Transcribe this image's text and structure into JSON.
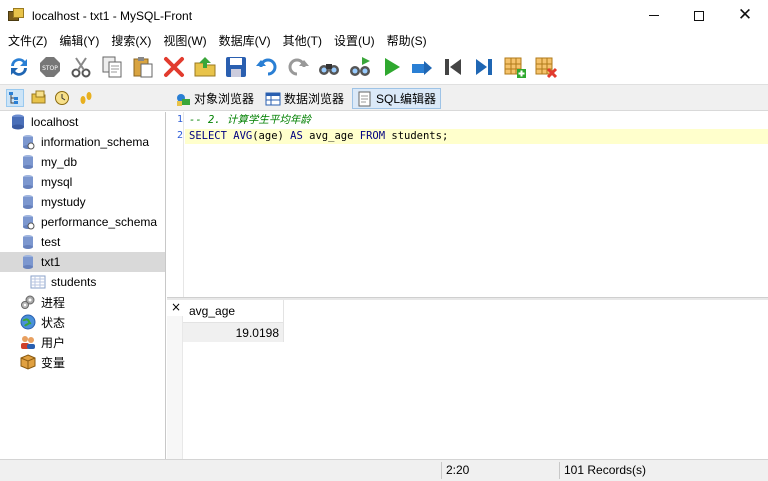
{
  "window": {
    "title": "localhost - txt1 - MySQL-Front",
    "minimize_label": "",
    "maximize_label": "",
    "close_label": "✕"
  },
  "menu": [
    "文件(Z)",
    "编辑(Y)",
    "搜索(X)",
    "视图(W)",
    "数据库(V)",
    "其他(T)",
    "设置(U)",
    "帮助(S)"
  ],
  "toolbar": {
    "icons": [
      "refresh-icon",
      "stop-icon",
      "cut-icon",
      "copy-icon",
      "paste-icon",
      "delete-icon",
      "open-icon",
      "save-icon",
      "undo-icon",
      "redo-icon",
      "find-icon",
      "replace-icon",
      "run-icon",
      "run-line-icon",
      "first-icon",
      "last-icon",
      "insert-row-icon",
      "delete-row-icon"
    ]
  },
  "views": {
    "object_browser": "对象浏览器",
    "data_browser": "数据浏览器",
    "sql_editor": "SQL编辑器"
  },
  "tree": {
    "root": "localhost",
    "databases": [
      "information_schema",
      "my_db",
      "mysql",
      "mystudy",
      "performance_schema",
      "test",
      "txt1"
    ],
    "selected": "txt1",
    "table": "students",
    "extras": [
      "进程",
      "状态",
      "用户",
      "变量"
    ]
  },
  "editor": {
    "line_numbers": [
      "1",
      "2"
    ],
    "line1_comment": "-- 2. 计算学生平均年龄",
    "line2": {
      "kw_select": "SELECT",
      "kw_avg": "AVG",
      "arg": "(age)",
      "kw_as": "AS",
      "alias": "avg_age",
      "kw_from": "FROM",
      "table": "students;"
    }
  },
  "results": {
    "close_label": "×",
    "column": "avg_age",
    "value": "19.0198"
  },
  "status": {
    "position": "2:20",
    "records": "101 Records(s)"
  },
  "colors": {
    "current_line": "#ffffcc",
    "line_number": "#2b5bd7",
    "comment": "#008000",
    "keyword": "#000080",
    "selection": "#d9d9d9"
  }
}
